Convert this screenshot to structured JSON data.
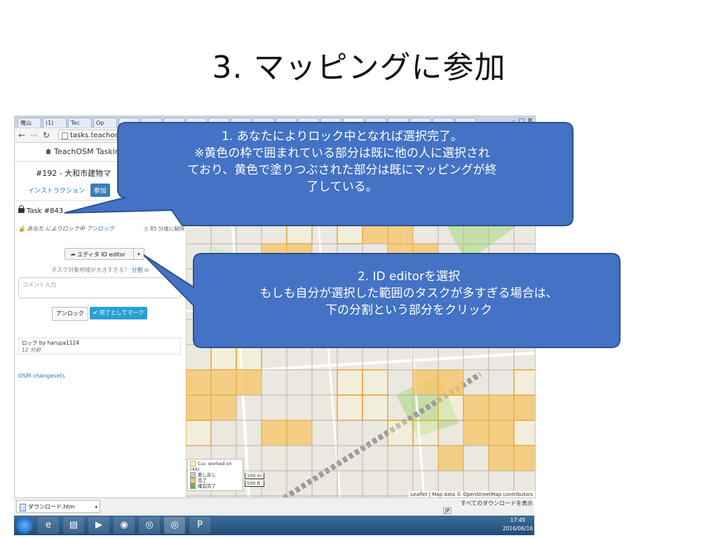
{
  "slide": {
    "title": "3. マッピングに参加"
  },
  "browser": {
    "tabs": [
      "俺山",
      "(1)",
      "Tec",
      "Op"
    ],
    "url": "tasks.teachosm"
  },
  "panel": {
    "header": "TeachOSM Tasking",
    "project": "#192 - 大和市建物マ",
    "tabs": [
      "インストラクション",
      "参加"
    ],
    "task_label": "Task #843",
    "locked_prefix": "あなた によりロック中",
    "unlock_link": "アンロック",
    "clock": "85 分後に解除",
    "editor_button": "エディタ ID editor",
    "split_question": "タスク対象地域が大きすぎる？",
    "split_link": "分割",
    "comment_placeholder": "コメント入力",
    "unlock_button": "アンロック",
    "done_button": "✔ 完了としてマーク",
    "history_line1": "ロック by harupa1124",
    "history_line2": "12 分前",
    "osm_changesets": "OSM changesets"
  },
  "map": {
    "legend": [
      "Cur. worked on (44)",
      "差し戻し",
      "完了",
      "確認完了"
    ],
    "scale": [
      "100 m",
      "500 ft"
    ],
    "attribution": "Leaflet | Map data © OpenStreetMap contributors",
    "colors": {
      "orange_fill": "#f5c66d",
      "orange_stroke": "#e6a534",
      "grid": "#b9b2a6",
      "road": "#ffffff",
      "green": "#c5dfa8",
      "rail": "#9d9d9d"
    }
  },
  "download_bar": {
    "file": "ダウンロード.htm",
    "right": "すべてのダウンロードを表示"
  },
  "taskbar": {
    "ime": "JP",
    "time": "17:49",
    "date": "2016/06/16"
  },
  "callouts": {
    "c1_lines": [
      "1. あなたによりロック中となれば選択完了。",
      "※黄色の枠で囲まれている部分は既に他の人に選択され",
      "ており、黄色で塗りつぶされた部分は既にマッピングが終",
      "了している。"
    ],
    "c2_lines": [
      "2. ID editorを選択",
      "もしも自分が選択した範囲のタスクが多すぎる場合は、",
      "下の分割という部分をクリック"
    ],
    "fill": "#4472c4",
    "stroke": "#2f528f"
  }
}
